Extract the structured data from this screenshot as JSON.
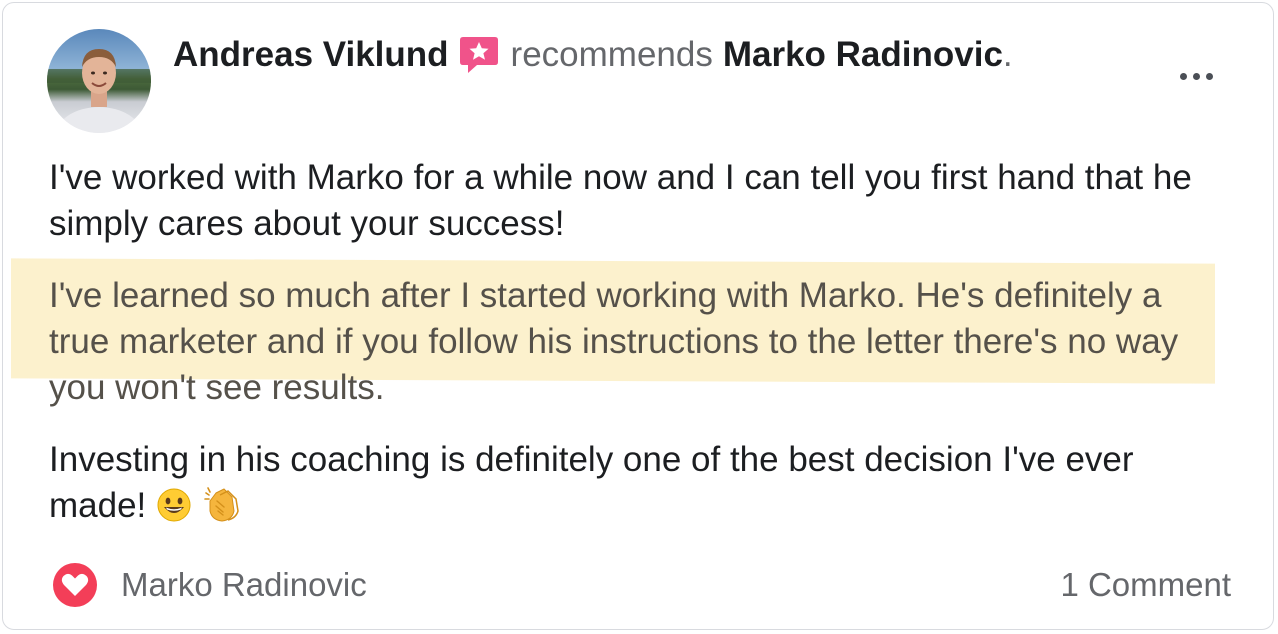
{
  "post": {
    "author": "Andreas Viklund",
    "action": "recommends",
    "recipient": "Marko Radinovic",
    "period": ".",
    "more_icon": "more-horizontal-icon",
    "badge_icon": "recommendation-star-icon",
    "paragraph_1": "I've worked with Marko for a while now and I can tell you first hand that he simply cares about your success!",
    "paragraph_2": "I've learned so much after I started working with Marko. He's definitely a true marketer and if you follow his instructions to the letter there's no way you won't see results.",
    "paragraph_3": "Investing in his coaching is definitely one of the best decision I've ever made!",
    "emojis": [
      "grinning-face-icon",
      "clapping-hands-icon"
    ]
  },
  "footer": {
    "reaction_icon": "heart-love-icon",
    "reactor_name": "Marko Radinovic",
    "comments_label": "1 Comment"
  },
  "colors": {
    "text_primary": "#1c1e21",
    "text_secondary": "#65676b",
    "highlight": "#fcefc4",
    "love_red": "#f33e58",
    "badge_pink": "#f0538a"
  }
}
